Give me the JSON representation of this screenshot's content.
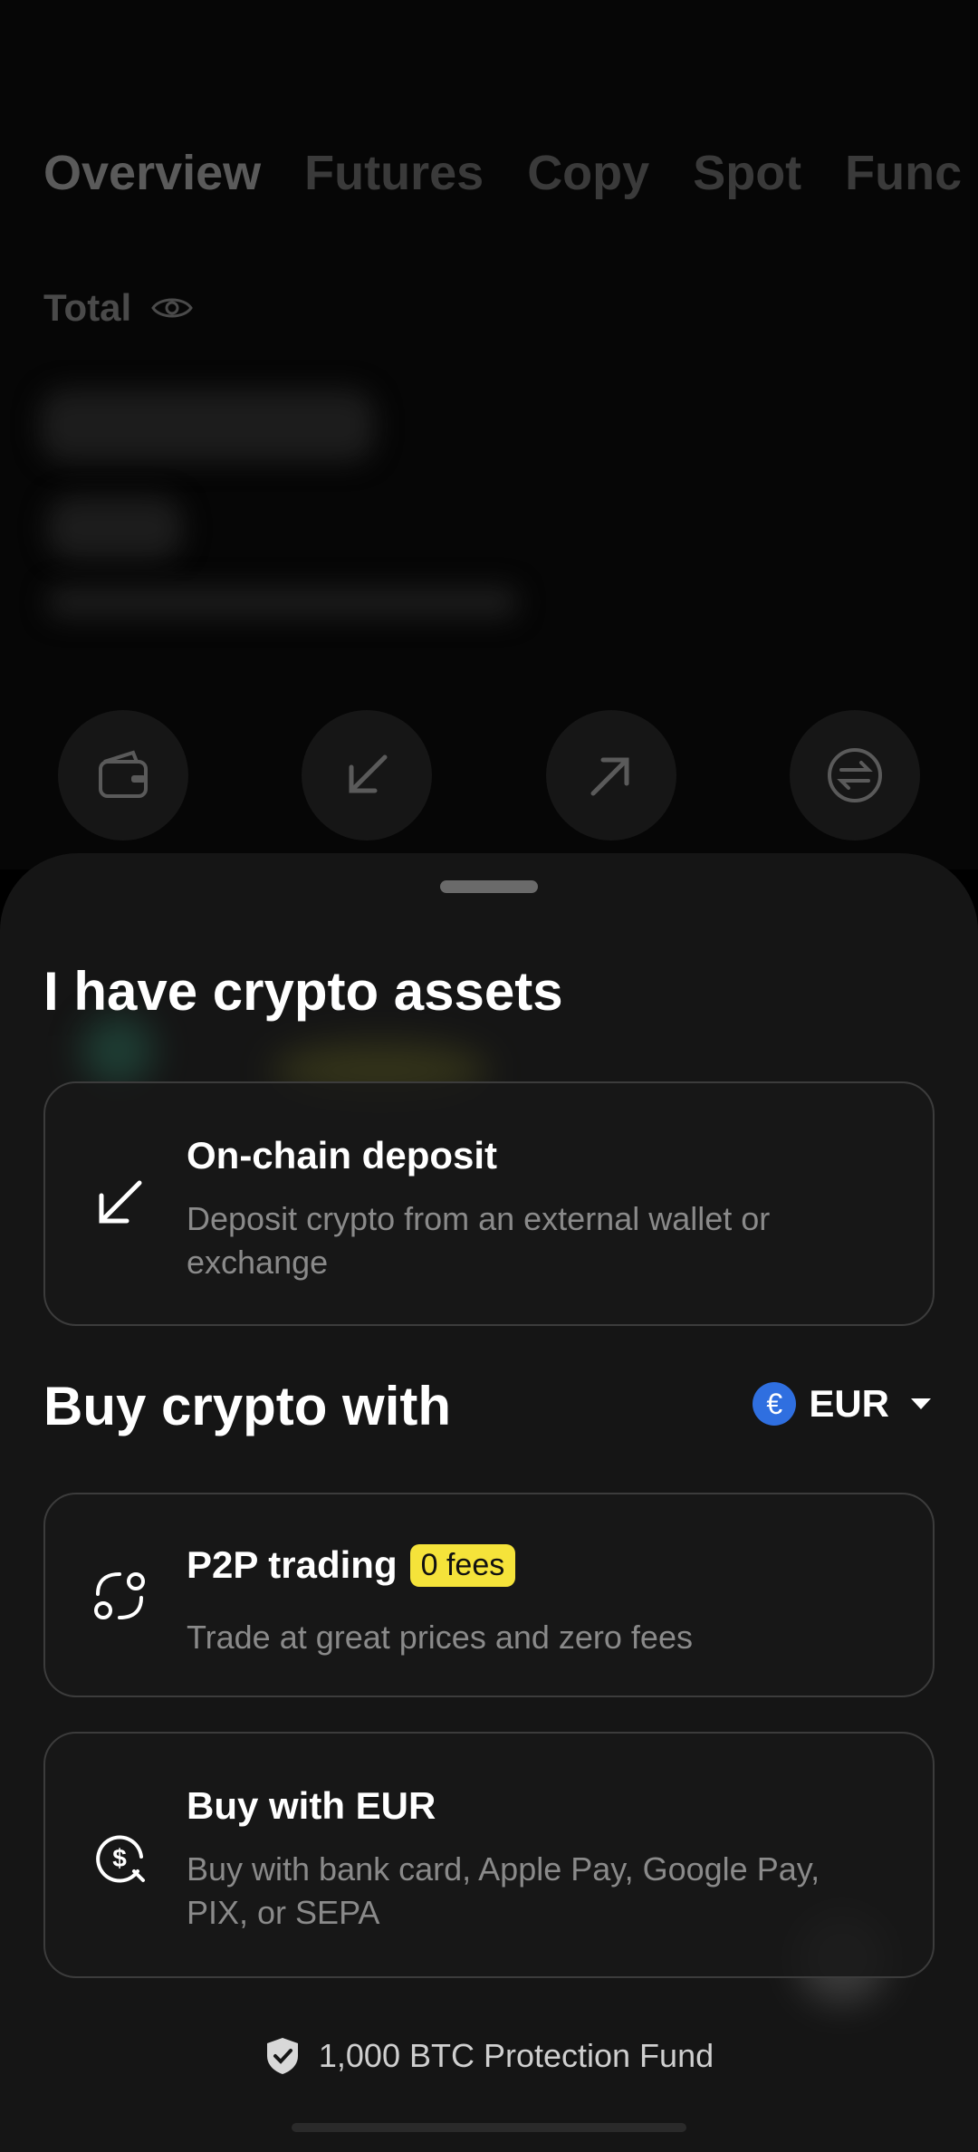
{
  "tabs": [
    "Overview",
    "Futures",
    "Copy",
    "Spot",
    "Func"
  ],
  "total": {
    "label": "Total"
  },
  "quick_actions": [
    {
      "icon": "wallet-icon"
    },
    {
      "icon": "deposit-arrow-icon"
    },
    {
      "icon": "send-arrow-icon"
    },
    {
      "icon": "transfer-icon"
    }
  ],
  "sheet": {
    "crypto_section_title": "I have crypto assets",
    "onchain": {
      "title": "On-chain deposit",
      "desc": "Deposit crypto from an external wallet or exchange",
      "icon": "deposit-arrow-icon"
    },
    "buy_section_title": "Buy crypto with",
    "currency": {
      "symbol": "€",
      "code": "EUR",
      "color": "#2f6fe0"
    },
    "p2p": {
      "title": "P2P trading",
      "badge": "0 fees",
      "desc": "Trade at great prices and zero fees",
      "icon": "p2p-icon"
    },
    "buy_eur": {
      "title": "Buy with EUR",
      "desc": "Buy with bank card, Apple Pay, Google Pay, PIX, or SEPA",
      "icon": "dollar-coin-icon"
    },
    "footer": {
      "text": "1,000 BTC Protection Fund",
      "icon": "shield-icon"
    }
  },
  "colors": {
    "accent_badge": "#f5e33a",
    "sheet_bg": "#151515",
    "card_border": "#3c3c3c"
  }
}
